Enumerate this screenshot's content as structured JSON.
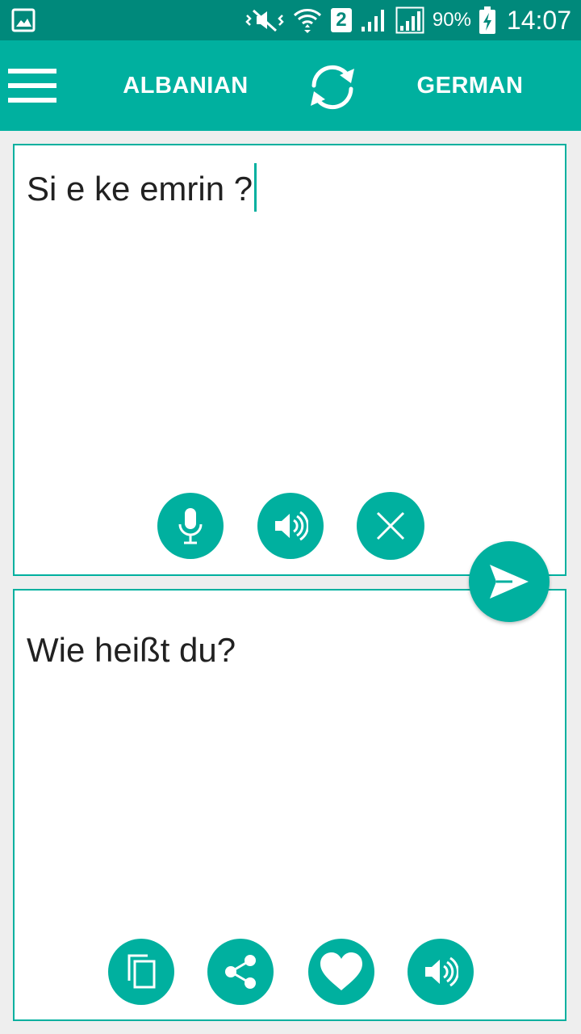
{
  "status_bar": {
    "battery_percent": "90%",
    "time": "14:07",
    "sim_slot": "2",
    "icons": [
      "image-notification-icon",
      "mute-vibrate-icon",
      "wifi-icon",
      "sim-icon",
      "signal-icon",
      "signal-icon-2",
      "battery-charging-icon"
    ]
  },
  "app_bar": {
    "source_language": "ALBANIAN",
    "target_language": "GERMAN",
    "icons": [
      "menu-icon",
      "swap-languages-icon"
    ]
  },
  "source_panel": {
    "text": "Si e ke emrin ?",
    "icons": [
      "microphone-icon",
      "speaker-icon",
      "close-icon"
    ]
  },
  "target_panel": {
    "text": "Wie heißt du?",
    "icons": [
      "copy-icon",
      "share-icon",
      "heart-icon",
      "speaker-icon"
    ]
  },
  "send_button": {
    "icon": "send-icon"
  },
  "colors": {
    "status_bar": "#00897b",
    "accent": "#00b09f",
    "background": "#eeeeee",
    "panel": "#ffffff",
    "text": "#212121"
  }
}
